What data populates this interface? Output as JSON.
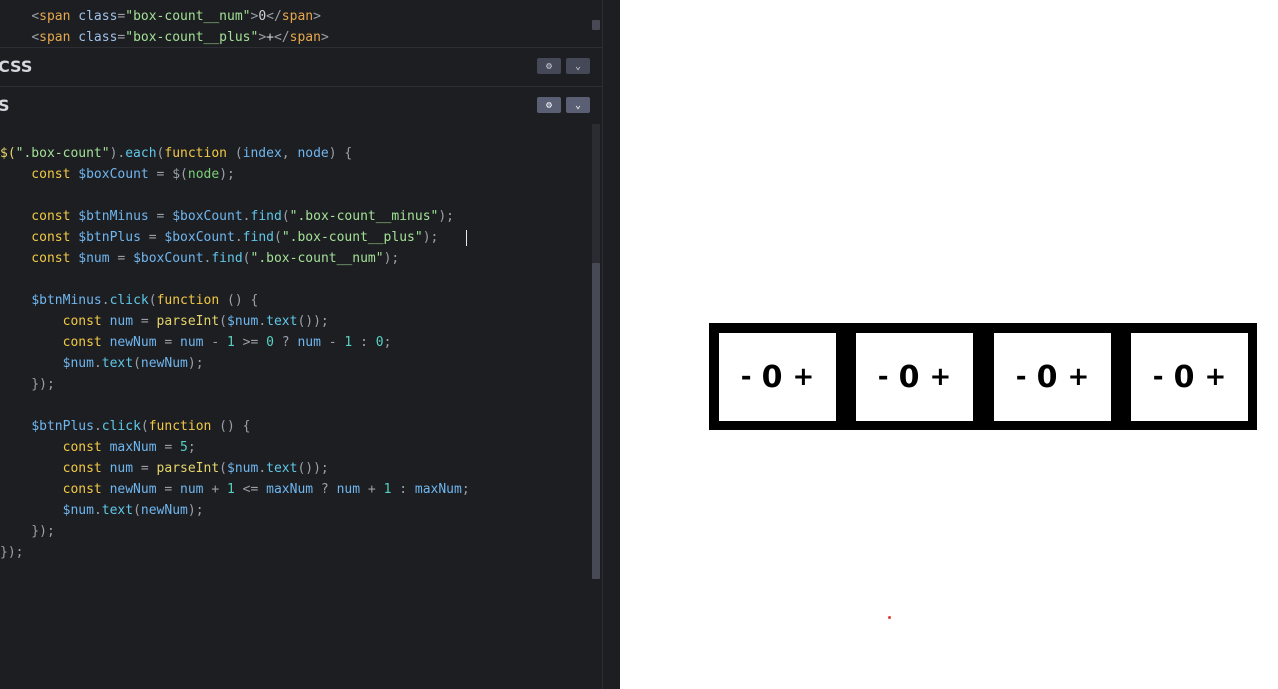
{
  "html_panel": {
    "line1": {
      "indent": "    ",
      "lt": "<",
      "tag": "span",
      "attr": "class",
      "eq": "=",
      "value": "\"box-count__num\"",
      "gt": ">",
      "text": "0",
      "close": "</",
      "ctag": "span",
      "cgt": ">"
    },
    "line2": {
      "indent": "    ",
      "lt": "<",
      "tag": "span",
      "attr": "class",
      "eq": "=",
      "value": "\"box-count__plus\"",
      "gt": ">",
      "text": "+",
      "close": "</",
      "ctag": "span",
      "cgt": ">"
    }
  },
  "css_panel": {
    "title": "CSS"
  },
  "js_panel": {
    "title": "S",
    "settings_icon": "gear-icon",
    "collapse_icon": "chevron-down-icon"
  },
  "js_code": {
    "l1": {
      "a": "$(",
      "b": "\".box-count\"",
      "c": ").",
      "d": "each",
      "e": "(",
      "f": "function",
      "g": " (",
      "h": "index",
      "i": ", ",
      "j": "node",
      "k": ") {"
    },
    "l2": {
      "a": "    const ",
      "b": "$boxCount",
      "c": " = $(",
      "d": "node",
      "e": ");"
    },
    "l4": {
      "a": "    const ",
      "b": "$btnMinus",
      "c": " = ",
      "d": "$boxCount",
      "e": ".",
      "f": "find",
      "g": "(",
      "h": "\".box-count__minus\"",
      "i": ");"
    },
    "l5": {
      "a": "    const ",
      "b": "$btnPlus",
      "c": " = ",
      "d": "$boxCount",
      "e": ".",
      "f": "find",
      "g": "(",
      "h": "\".box-count__plus\"",
      "i": ");"
    },
    "l6": {
      "a": "    const ",
      "b": "$num",
      "c": " = ",
      "d": "$boxCount",
      "e": ".",
      "f": "find",
      "g": "(",
      "h": "\".box-count__num\"",
      "i": ");"
    },
    "l8": {
      "a": "    ",
      "b": "$btnMinus",
      "c": ".",
      "d": "click",
      "e": "(",
      "f": "function",
      "g": " () {"
    },
    "l9": {
      "a": "        const ",
      "b": "num",
      "c": " = ",
      "d": "parseInt",
      "e": "(",
      "f": "$num",
      "g": ".",
      "h": "text",
      "i": "());"
    },
    "l10": {
      "a": "        const ",
      "b": "newNum",
      "c": " = ",
      "d": "num",
      "e": " - ",
      "f": "1",
      "g": " >= ",
      "h": "0",
      "i": " ? ",
      "j": "num",
      "k": " - ",
      "l": "1",
      "m": " : ",
      "n": "0",
      "o": ";"
    },
    "l11": {
      "a": "        ",
      "b": "$num",
      "c": ".",
      "d": "text",
      "e": "(",
      "f": "newNum",
      "g": ");"
    },
    "l12": {
      "a": "    });"
    },
    "l14": {
      "a": "    ",
      "b": "$btnPlus",
      "c": ".",
      "d": "click",
      "e": "(",
      "f": "function",
      "g": " () {"
    },
    "l15": {
      "a": "        const ",
      "b": "maxNum",
      "c": " = ",
      "d": "5",
      "e": ";"
    },
    "l16": {
      "a": "        const ",
      "b": "num",
      "c": " = ",
      "d": "parseInt",
      "e": "(",
      "f": "$num",
      "g": ".",
      "h": "text",
      "i": "());"
    },
    "l17": {
      "a": "        const ",
      "b": "newNum",
      "c": " = ",
      "d": "num",
      "e": " + ",
      "f": "1",
      "g": " <= ",
      "h": "maxNum",
      "i": " ? ",
      "j": "num",
      "k": " + ",
      "l": "1",
      "m": " : ",
      "n": "maxNum",
      "o": ";"
    },
    "l18": {
      "a": "        ",
      "b": "$num",
      "c": ".",
      "d": "text",
      "e": "(",
      "f": "newNum",
      "g": ");"
    },
    "l19": {
      "a": "    });"
    },
    "l20": {
      "a": "});"
    }
  },
  "preview": {
    "counters": [
      {
        "minus": "-",
        "num": "0",
        "plus": "+"
      },
      {
        "minus": "-",
        "num": "0",
        "plus": "+"
      },
      {
        "minus": "-",
        "num": "0",
        "plus": "+"
      },
      {
        "minus": "-",
        "num": "0",
        "plus": "+"
      }
    ]
  },
  "colors": {
    "editor_bg": "#1d1e22",
    "preview_bg": "#ffffff",
    "counter_strip": "#000000"
  }
}
